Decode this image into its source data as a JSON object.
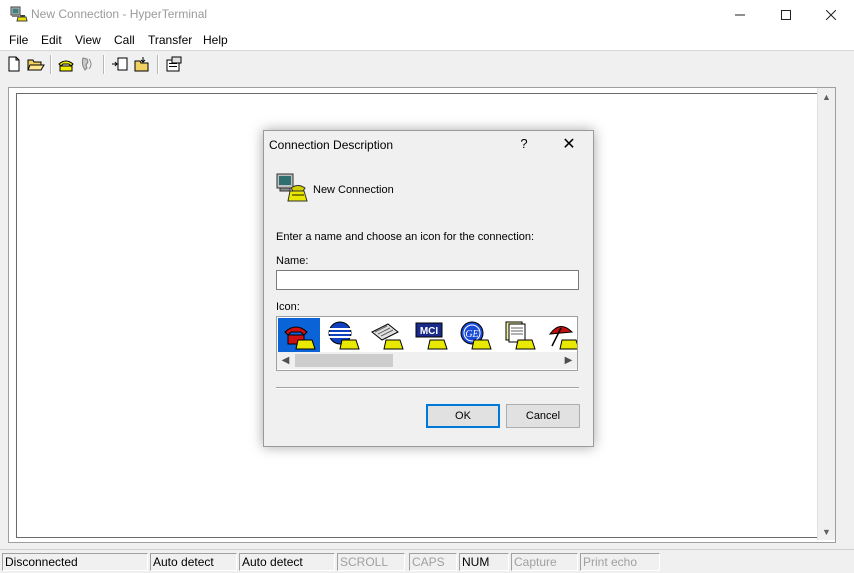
{
  "window": {
    "title": "New Connection - HyperTerminal",
    "minimize_icon": "minimize-icon",
    "maximize_icon": "maximize-icon",
    "close_icon": "close-icon"
  },
  "menu": [
    "File",
    "Edit",
    "View",
    "Call",
    "Transfer",
    "Help"
  ],
  "toolbar": {
    "buttons": [
      "new-file-icon",
      "open-folder-icon",
      "phone-call-icon",
      "phone-disconnect-icon",
      "send-file-icon",
      "receive-file-icon",
      "properties-icon"
    ]
  },
  "dialog": {
    "title": "Connection Description",
    "help_label": "?",
    "close_label": "✕",
    "connection_name": "New Connection",
    "instruction": "Enter a name and choose an icon for the connection:",
    "name_label": "Name:",
    "name_value": "",
    "icon_label": "Icon:",
    "icons": [
      "red-phone-icon",
      "globe-stripes-icon",
      "fax-machine-icon",
      "mci-icon",
      "ge-icon",
      "documents-icon",
      "umbrella-icon"
    ],
    "mci_text": "MCI",
    "ge_text": "GE",
    "ok_label": "OK",
    "cancel_label": "Cancel"
  },
  "statusbar": {
    "connection": "Disconnected",
    "detect1": "Auto detect",
    "detect2": "Auto detect",
    "scroll": "SCROLL",
    "caps": "CAPS",
    "num": "NUM",
    "capture": "Capture",
    "print_echo": "Print echo"
  },
  "colors": {
    "selection": "#0a64d8",
    "default_button_border": "#0078d7"
  }
}
